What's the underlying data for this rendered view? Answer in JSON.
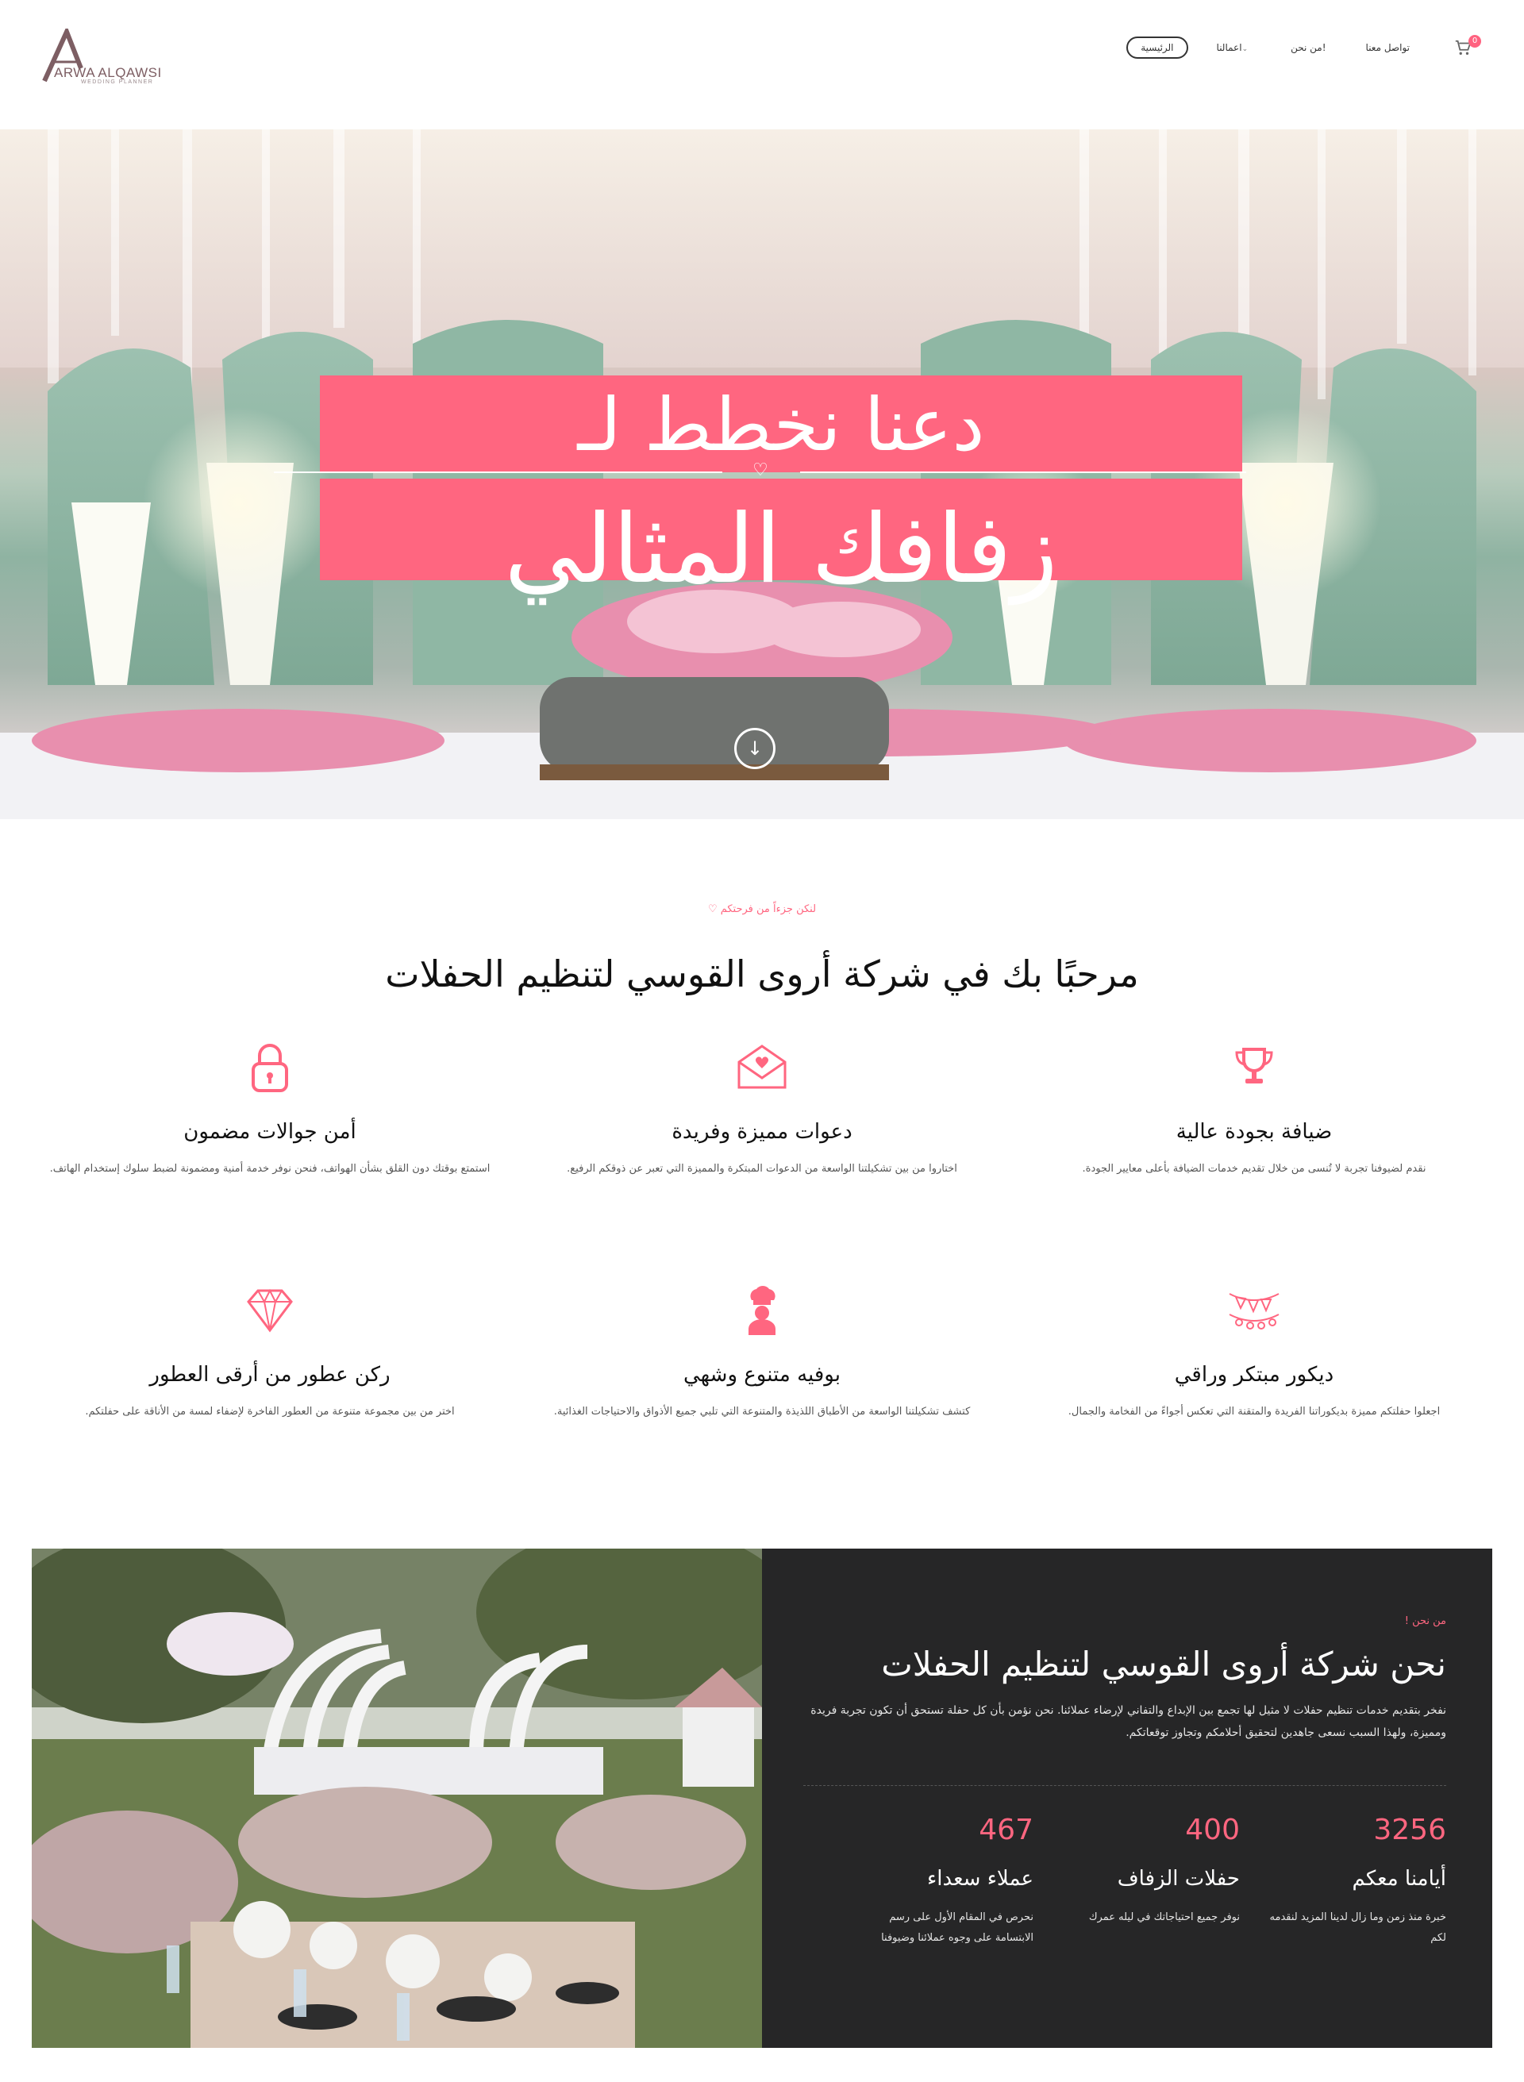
{
  "header": {
    "logo_text": "ARWA ALQAWSI",
    "logo_sub": "WEDDING PLANNER",
    "cart_count": "0",
    "nav": [
      {
        "label": "تواصل معنا"
      },
      {
        "label": "من نحن!"
      },
      {
        "label": "اعمالنا"
      },
      {
        "label": "الرئيسية"
      }
    ]
  },
  "hero": {
    "line1": "دعنا نخطط لـ",
    "line2": "زفافك المثالي",
    "scroll_icon": "arrow-down-circle-icon"
  },
  "features_section": {
    "eyebrow": "لنكن جزءاً من فرحتكم ♡",
    "title": "مرحبًا بك في شركة أروى القوسي لتنظيم الحفلات",
    "items": [
      {
        "icon": "trophy-icon",
        "title": "ضيافة بجودة عالية",
        "desc": "نقدم لضيوفنا تجربة لا تُنسى من خلال تقديم خدمات الضيافة بأعلى معايير الجودة."
      },
      {
        "icon": "envelope-heart-icon",
        "title": "دعوات مميزة وفريدة",
        "desc": "اختاروا من بين تشكيلتنا الواسعة من الدعوات المبتكرة والمميزة التي تعبر عن ذوقكم الرفيع."
      },
      {
        "icon": "lock-icon",
        "title": "أمن جوالات مضمون",
        "desc": "استمتع بوقتك دون القلق بشأن الهواتف، فنحن نوفر خدمة أمنية ومضمونة لضبط سلوك إستخدام الهاتف."
      },
      {
        "icon": "bunting-icon",
        "title": "ديكور مبتكر وراقي",
        "desc": "اجعلوا حفلتكم مميزة بديكوراتنا الفريدة والمتقنة التي تعكس أجواءً من الفخامة والجمال."
      },
      {
        "icon": "chef-icon",
        "title": "بوفيه متنوع وشهي",
        "desc": "كتشف تشكيلتنا الواسعة من الأطباق اللذيذة والمتنوعة التي تلبي جميع الأذواق والاحتياجات الغذائية."
      },
      {
        "icon": "diamond-icon",
        "title": "ركن عطور من أرقى العطور",
        "desc": "اختر من بين مجموعة متنوعة من العطور الفاخرة لإضفاء لمسة من الأناقة على حفلتكم."
      }
    ]
  },
  "about": {
    "eyebrow": "من نحن !",
    "title": "نحن شركة أروى القوسي لتنظيم الحفلات",
    "desc": "نفخر بتقديم خدمات تنظيم حفلات لا مثيل لها تجمع بين الإبداع والتفاني لإرضاء عملائنا. نحن نؤمن بأن كل حفلة تستحق أن تكون تجربة فريدة ومميزة، ولهذا السبب نسعى جاهدين لتحقيق أحلامكم وتجاوز توقعاتكم.",
    "stats": [
      {
        "number": "3256",
        "label": "أيامنا معكم",
        "desc": "خبرة منذ زمن وما زال لدينا المزيد لنقدمه لكم"
      },
      {
        "number": "400",
        "label": "حفلات الزفاف",
        "desc": "نوفر جميع احتياجاتك في ليله عمرك"
      },
      {
        "number": "467",
        "label": "عملاء سعداء",
        "desc": "نحرص في المقام الأول على رسم الابتسامة على وجوه عملائنا وضيوفنا"
      }
    ]
  },
  "colors": {
    "accent": "#ff6680",
    "dark": "#262627",
    "logo": "#7d5e63"
  }
}
